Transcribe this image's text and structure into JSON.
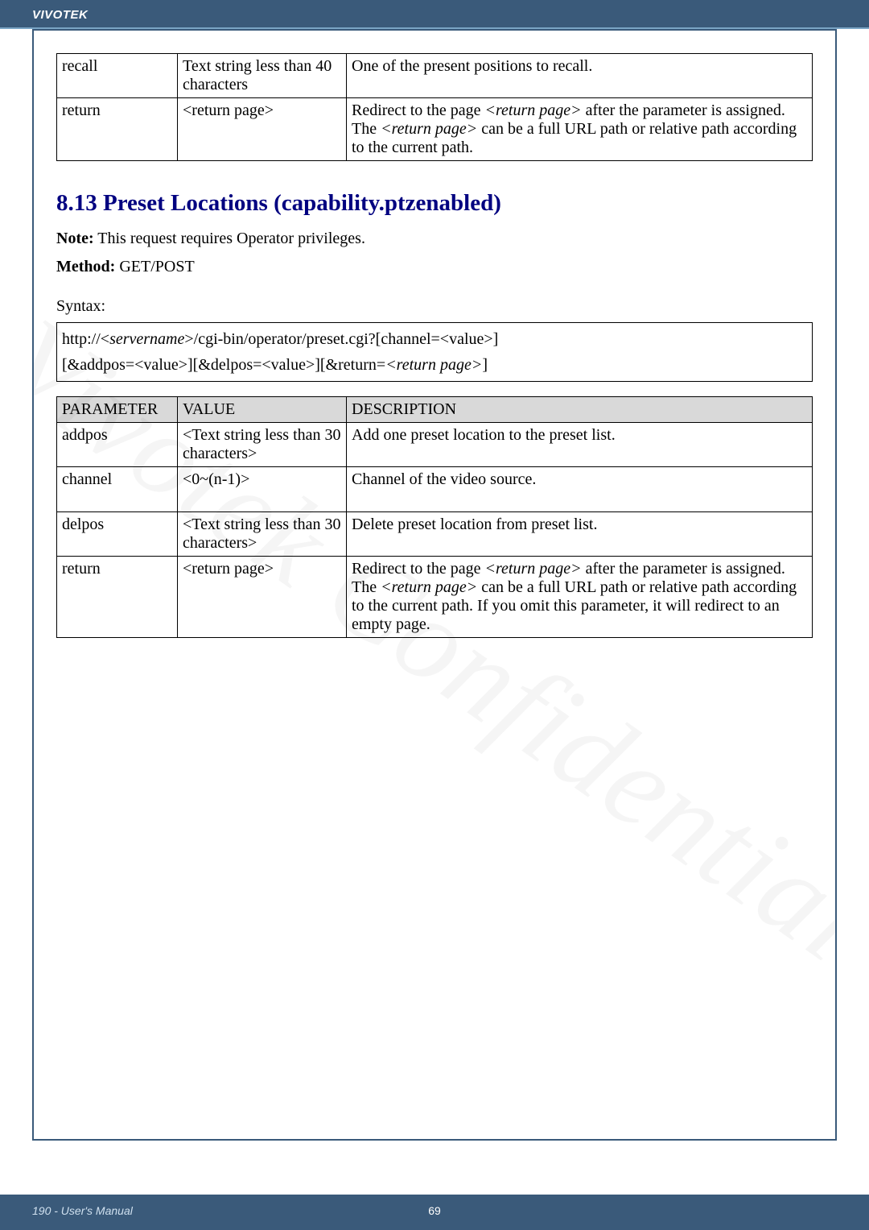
{
  "header": {
    "brand": "VIVOTEK"
  },
  "table_top": {
    "rows": [
      {
        "param": "recall",
        "value": "Text string less than 40 characters",
        "desc": "One of the present positions to recall."
      },
      {
        "param": "return",
        "value": "<return page>",
        "desc_pre": "Redirect to the page ",
        "desc_em1": "<return page>",
        "desc_mid": " after the parameter is assigned. The ",
        "desc_em2": "<return page>",
        "desc_post": " can be a full URL path or relative path according to the current path."
      }
    ]
  },
  "section": {
    "heading": "8.13 Preset Locations (capability.ptzenabled)",
    "note_label": "Note:",
    "note_text": " This request requires Operator privileges.",
    "method_label": "Method:",
    "method_text": " GET/POST",
    "syntax_label": "Syntax:",
    "syntax_line1_pre": "http://<",
    "syntax_line1_em": "servername",
    "syntax_line1_post": ">/cgi-bin/operator/preset.cgi?[channel=<value>]",
    "syntax_line2_pre": "[&addpos=<value>][&delpos=<value>][&return=",
    "syntax_line2_em": "<return page>",
    "syntax_line2_post": "]"
  },
  "table_params": {
    "headers": {
      "p": "PARAMETER",
      "v": "VALUE",
      "d": "DESCRIPTION"
    },
    "rows": [
      {
        "param": "addpos",
        "value": "<Text string less than 30 characters>",
        "desc": "Add one preset location to the preset list."
      },
      {
        "param": "channel",
        "value": "<0~(n-1)>",
        "desc": "Channel of the video source."
      },
      {
        "param": "delpos",
        "value": "<Text string less than 30 characters>",
        "desc": "Delete preset location from preset list."
      },
      {
        "param": "return",
        "value": "<return page>",
        "desc_pre": "Redirect to the page ",
        "desc_em1": "<return page>",
        "desc_mid": " after the parameter is assigned. The ",
        "desc_em2": "<return page>",
        "desc_post": " can be a full URL path or relative path according to the current path. If you omit this parameter, it will redirect to an empty page."
      }
    ]
  },
  "watermark": "Vivotek Confidential",
  "footer": {
    "left": "190 - User's Manual",
    "center": "69"
  }
}
